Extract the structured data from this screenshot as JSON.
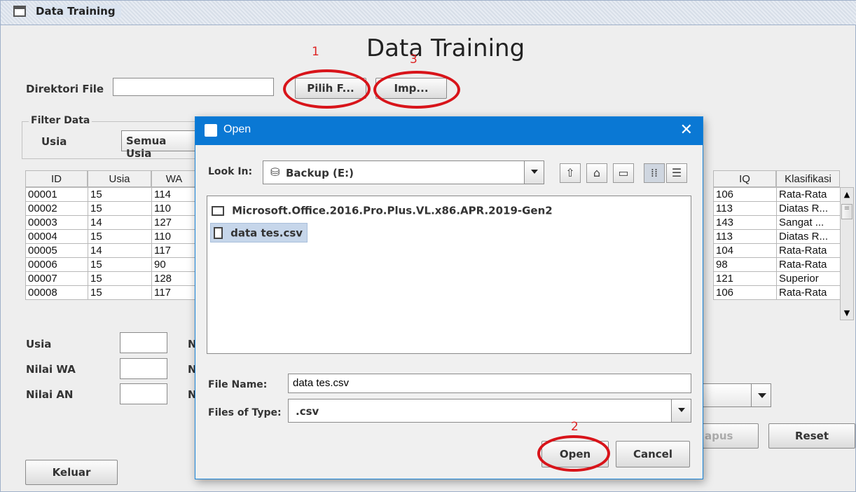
{
  "window": {
    "title": "Data Training"
  },
  "main": {
    "heading": "Data Training",
    "dir_label": "Direktori File",
    "dir_value": "",
    "choose_button": "Pilih F...",
    "import_button": "Imp...",
    "filter_title": "Filter Data",
    "filter_usia_label": "Usia",
    "filter_usia_value": "Semua Usia",
    "table": {
      "headers_left": [
        "ID",
        "Usia",
        "WA"
      ],
      "headers_right": [
        "IQ",
        "Klasifikasi"
      ],
      "rows": [
        {
          "id": "00001",
          "usia": "15",
          "wa": "114",
          "iq": "106",
          "klas": "Rata-Rata"
        },
        {
          "id": "00002",
          "usia": "15",
          "wa": "110",
          "iq": "113",
          "klas": "Diatas R..."
        },
        {
          "id": "00003",
          "usia": "14",
          "wa": "127",
          "iq": "143",
          "klas": "Sangat ..."
        },
        {
          "id": "00004",
          "usia": "15",
          "wa": "110",
          "iq": "113",
          "klas": "Diatas R..."
        },
        {
          "id": "00005",
          "usia": "14",
          "wa": "117",
          "iq": "104",
          "klas": "Rata-Rata"
        },
        {
          "id": "00006",
          "usia": "15",
          "wa": "90",
          "iq": "98",
          "klas": "Rata-Rata"
        },
        {
          "id": "00007",
          "usia": "15",
          "wa": "128",
          "iq": "121",
          "klas": "Superior"
        },
        {
          "id": "00008",
          "usia": "15",
          "wa": "117",
          "iq": "106",
          "klas": "Rata-Rata"
        }
      ]
    },
    "form": {
      "usia_label": "Usia",
      "wa_label": "Nilai WA",
      "an_label": "Nilai AN",
      "n1": "N",
      "n2": "N",
      "n3": "N"
    },
    "hapus_button": "apus",
    "reset_button": "Reset",
    "exit_button": "Keluar"
  },
  "annotations": {
    "a1": "1",
    "a2": "2",
    "a3": "3"
  },
  "dialog": {
    "title": "Open",
    "close": "✕",
    "look_in_label": "Look In:",
    "look_in_mnemonic": "I",
    "look_in_value": "Backup (E:)",
    "items": [
      {
        "name": "Microsoft.Office.2016.Pro.Plus.VL.x86.APR.2019-Gen2",
        "kind": "folder"
      },
      {
        "name": "data tes.csv",
        "kind": "file"
      }
    ],
    "file_name_label": "File Name:",
    "file_name_value": "data tes.csv",
    "file_type_label": "Files of Type:",
    "file_type_value": ".csv",
    "open_button": "Open",
    "cancel_button": "Cancel"
  }
}
